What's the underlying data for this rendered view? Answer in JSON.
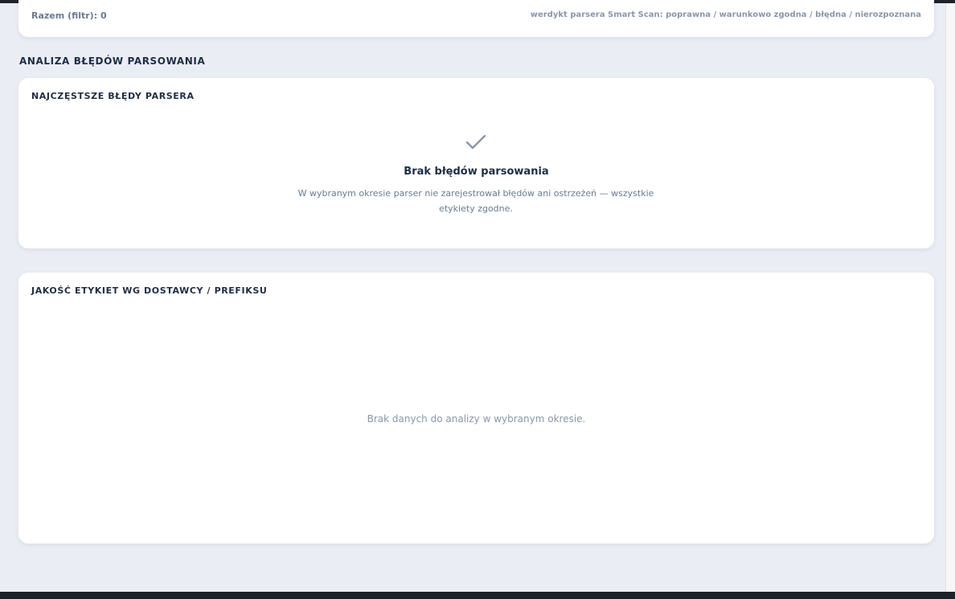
{
  "summary": {
    "total": "Razem (filtr): 0",
    "legend": "werdykt parsera Smart Scan: poprawna / warunkowo zgodna / błędna / nierozpoznana"
  },
  "section": {
    "title": "ANALIZA BŁĘDÓW PARSOWANIA"
  },
  "errors_card": {
    "title": "NAJCZĘSTSZE BŁĘDY PARSERA",
    "icon": "check-icon",
    "empty_title": "Brak błędów parsowania",
    "empty_desc": "W wybranym okresie parser nie zarejestrował błędów ani ostrzeżeń — wszystkie etykiety zgodne."
  },
  "quality_card": {
    "title": "JAKOŚĆ ETYKIET WG DOSTAWCY / PREFIKSU",
    "empty_text": "Brak danych do analizy w wybranym okresie."
  },
  "colors": {
    "background": "#eaedf4",
    "card": "#ffffff",
    "text_dark": "#1f2d44",
    "text_muted": "#6a7a92",
    "icon": "#8a97aa"
  }
}
